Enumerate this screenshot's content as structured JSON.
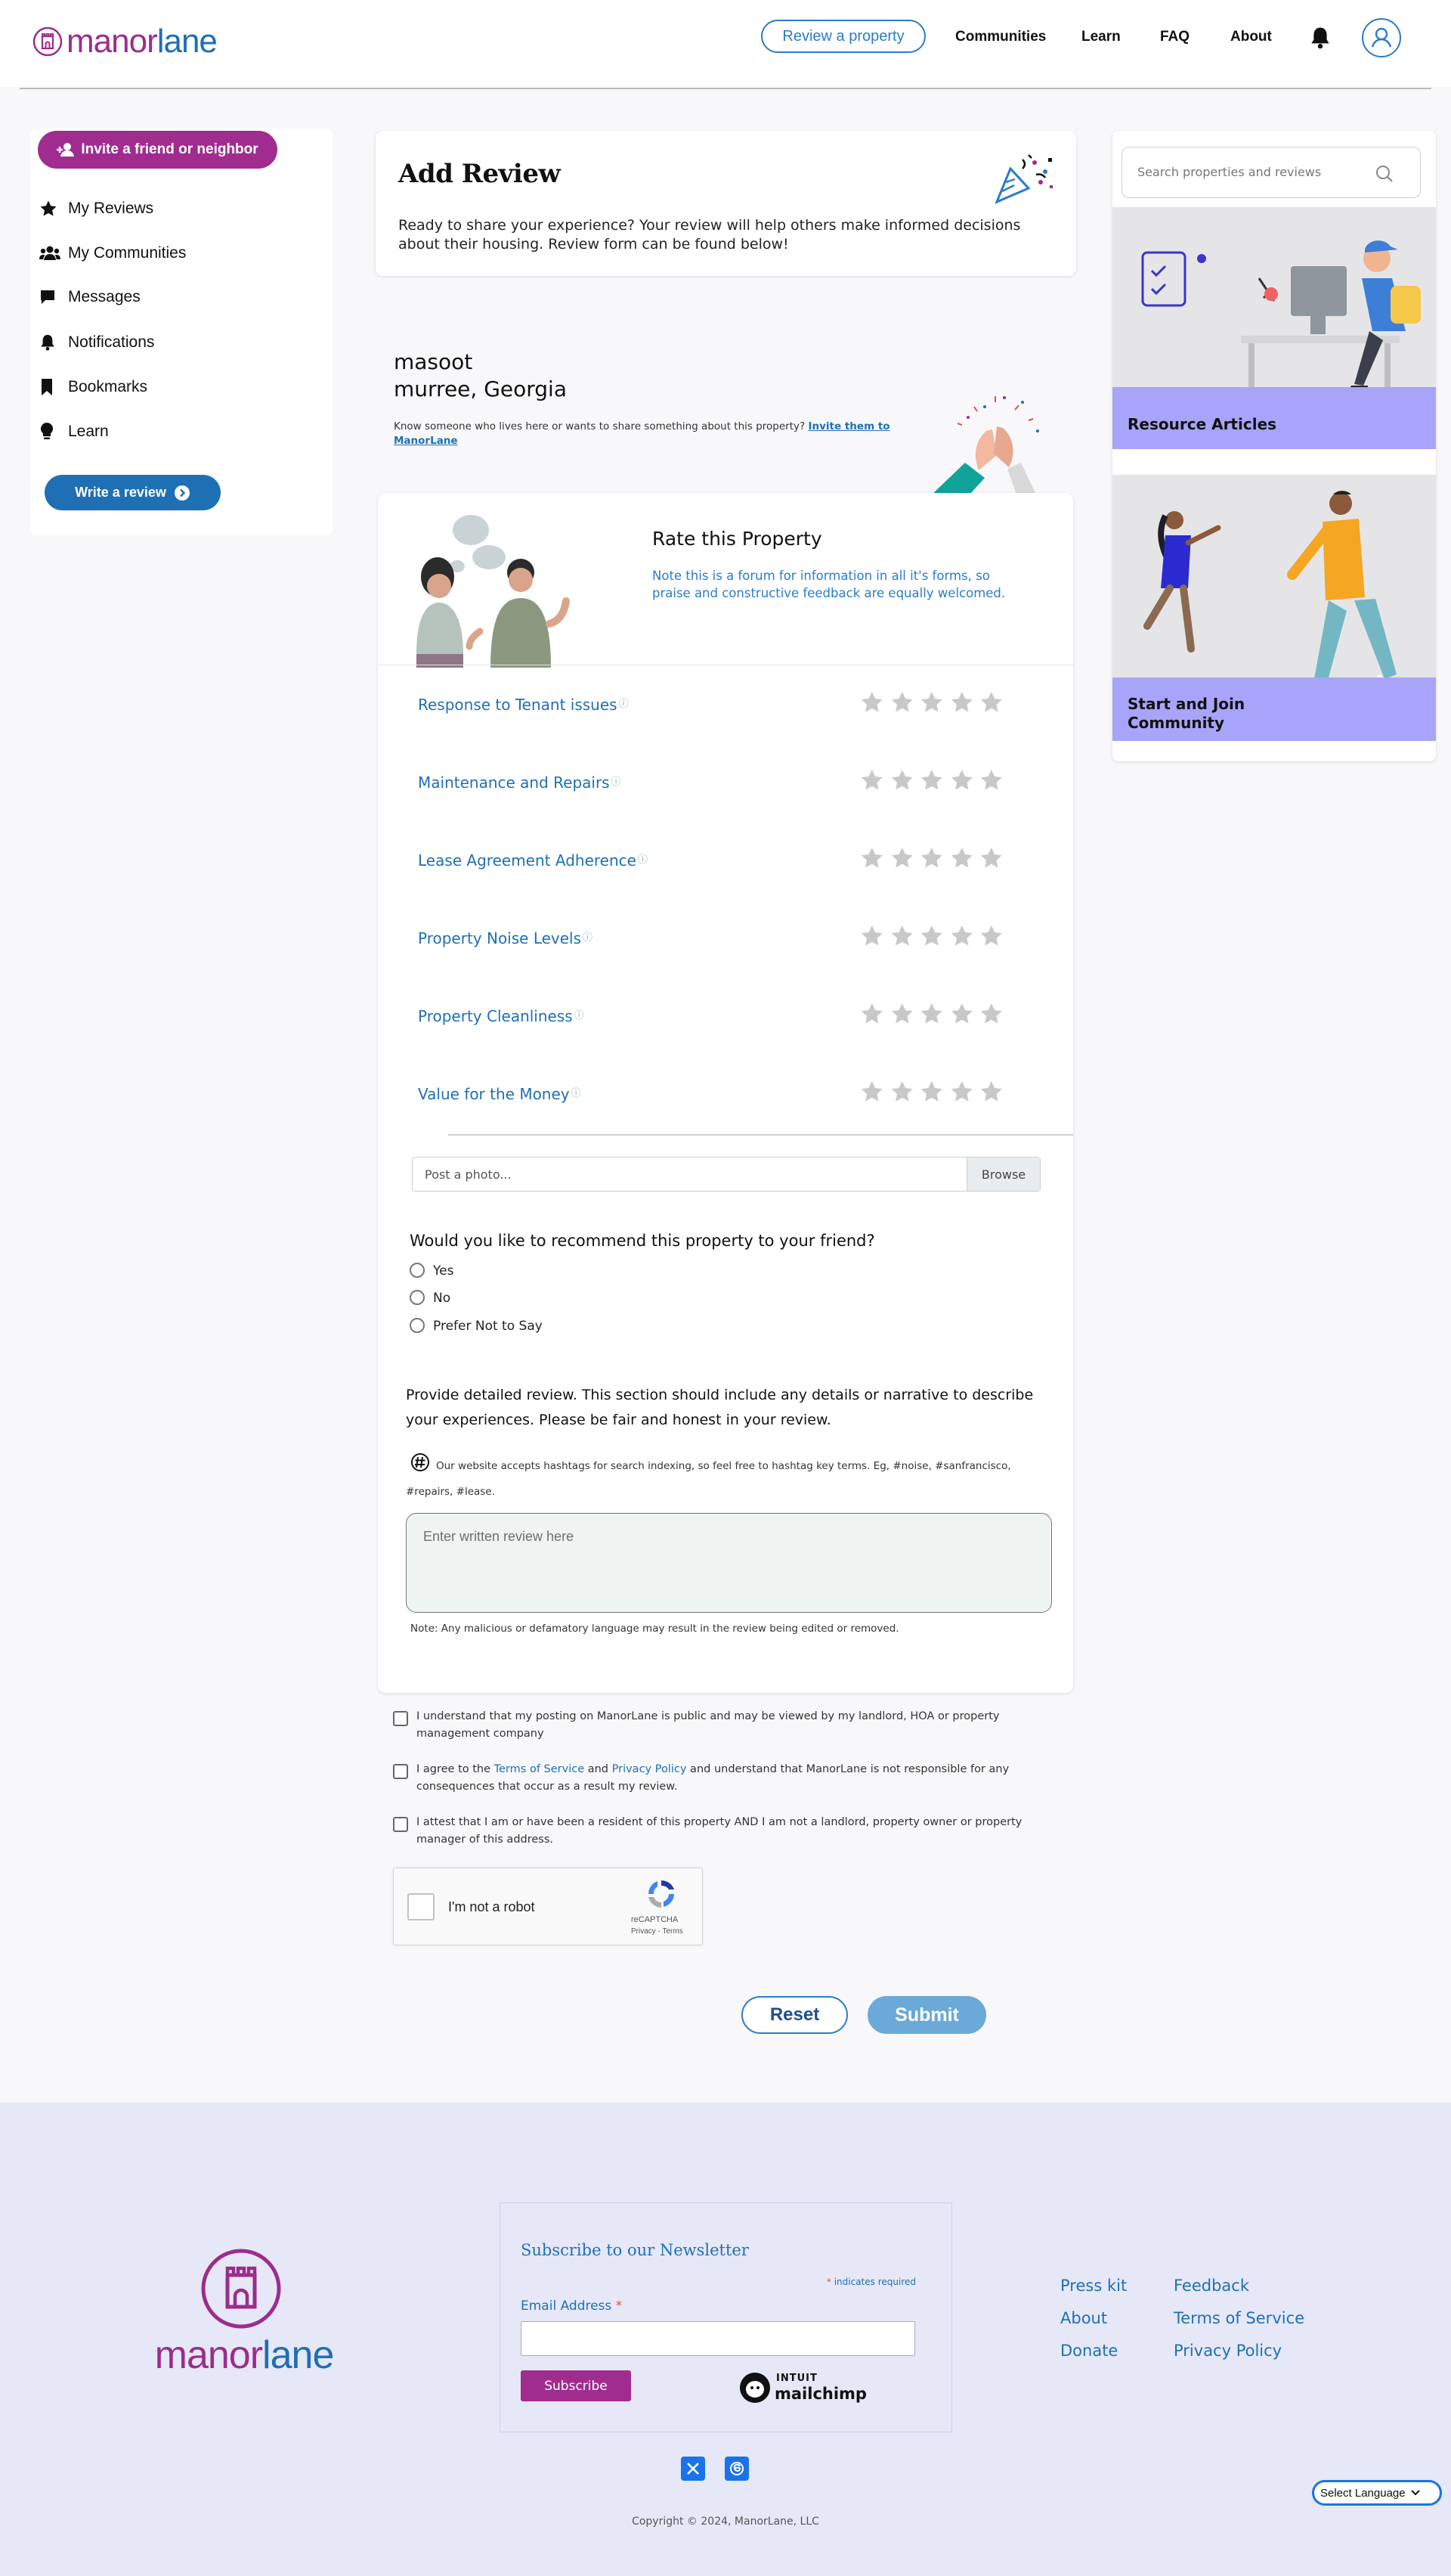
{
  "brand": {
    "name_part1": "manor",
    "name_part2": "lane",
    "color_purple": "#9b2d8c",
    "color_blue": "#1f6fb4"
  },
  "header": {
    "review_button": "Review a property",
    "nav": [
      "Communities",
      "Learn",
      "FAQ",
      "About"
    ],
    "icons": [
      "bell-icon",
      "user-icon"
    ]
  },
  "sidebar": {
    "invite_button": "Invite a friend or neighbor",
    "items": [
      {
        "label": "My Reviews",
        "icon": "star-icon"
      },
      {
        "label": "My Communities",
        "icon": "users-icon"
      },
      {
        "label": "Messages",
        "icon": "message-icon"
      },
      {
        "label": "Notifications",
        "icon": "bell-icon"
      },
      {
        "label": "Bookmarks",
        "icon": "bookmark-icon"
      },
      {
        "label": "Learn",
        "icon": "lightbulb-icon"
      }
    ],
    "write_button": "Write a review"
  },
  "add_review": {
    "title": "Add Review",
    "text": "Ready to share your experience? Your review will help others make informed decisions about their housing. Review form can be found below!"
  },
  "property": {
    "name": "masoot",
    "location": "murree, Georgia",
    "invite_text": "Know someone who lives here or wants to share something about this property?",
    "invite_link": "Invite them to ManorLane"
  },
  "rate": {
    "title": "Rate this Property",
    "note": "Note this is a forum for information in all it's forms, so praise and constructive feedback are equally welcomed.",
    "categories": [
      {
        "label": "Response to Tenant issues",
        "rating": 0
      },
      {
        "label": "Maintenance and Repairs",
        "rating": 0
      },
      {
        "label": "Lease Agreement Adherence",
        "rating": 0
      },
      {
        "label": "Property Noise Levels",
        "rating": 0
      },
      {
        "label": "Property Cleanliness",
        "rating": 0
      },
      {
        "label": "Value for the Money",
        "rating": 0
      }
    ],
    "max_stars": 5
  },
  "photo": {
    "placeholder": "Post a photo...",
    "browse": "Browse"
  },
  "recommend": {
    "question": "Would you like to recommend this property to your friend?",
    "options": [
      "Yes",
      "No",
      "Prefer Not to Say"
    ]
  },
  "detailed": {
    "instructions": "Provide detailed review. This section should include any details or narrative to describe your experiences. Please be fair and honest in your review.",
    "hashtag_note": "Our website accepts hashtags for search indexing, so feel free to hashtag key terms. Eg, #noise, #sanfrancisco, #repairs, #lease.",
    "placeholder": "Enter written review here",
    "note": "Note: Any malicious or defamatory language may result in the review being edited or removed."
  },
  "agreements": [
    {
      "text": "I understand that my posting on ManorLane is public and may be viewed by my landlord, HOA or property management company"
    },
    {
      "pre": "I agree to the ",
      "tos": "Terms of Service",
      "mid": " and ",
      "pp": "Privacy Policy",
      "post": " and understand that ManorLane is not responsible for any consequences that occur as a result my review."
    },
    {
      "text": "I attest that I am or have been a resident of this property AND I am not a landlord, property owner or property manager of this address."
    }
  ],
  "captcha": {
    "label": "I'm not a robot",
    "brand": "reCAPTCHA",
    "links": "Privacy - Terms"
  },
  "actions": {
    "reset": "Reset",
    "submit": "Submit"
  },
  "right_panel": {
    "search_placeholder": "Search properties and reviews",
    "cards": [
      "Resource Articles",
      "Start and Join Community"
    ]
  },
  "footer": {
    "newsletter_title": "Subscribe to our Newsletter",
    "required_note": "indicates required",
    "email_label": "Email Address",
    "subscribe": "Subscribe",
    "mailchimp_line1": "INTUIT",
    "mailchimp_line2": "mailchimp",
    "links_col1": [
      "Press kit",
      "About",
      "Donate"
    ],
    "links_col2": [
      "Feedback",
      "Terms of Service",
      "Privacy Policy"
    ],
    "copyright": "Copyright © 2024, ManorLane, LLC",
    "language": "Select Language",
    "social_icons": [
      "x-icon",
      "threads-icon"
    ]
  }
}
